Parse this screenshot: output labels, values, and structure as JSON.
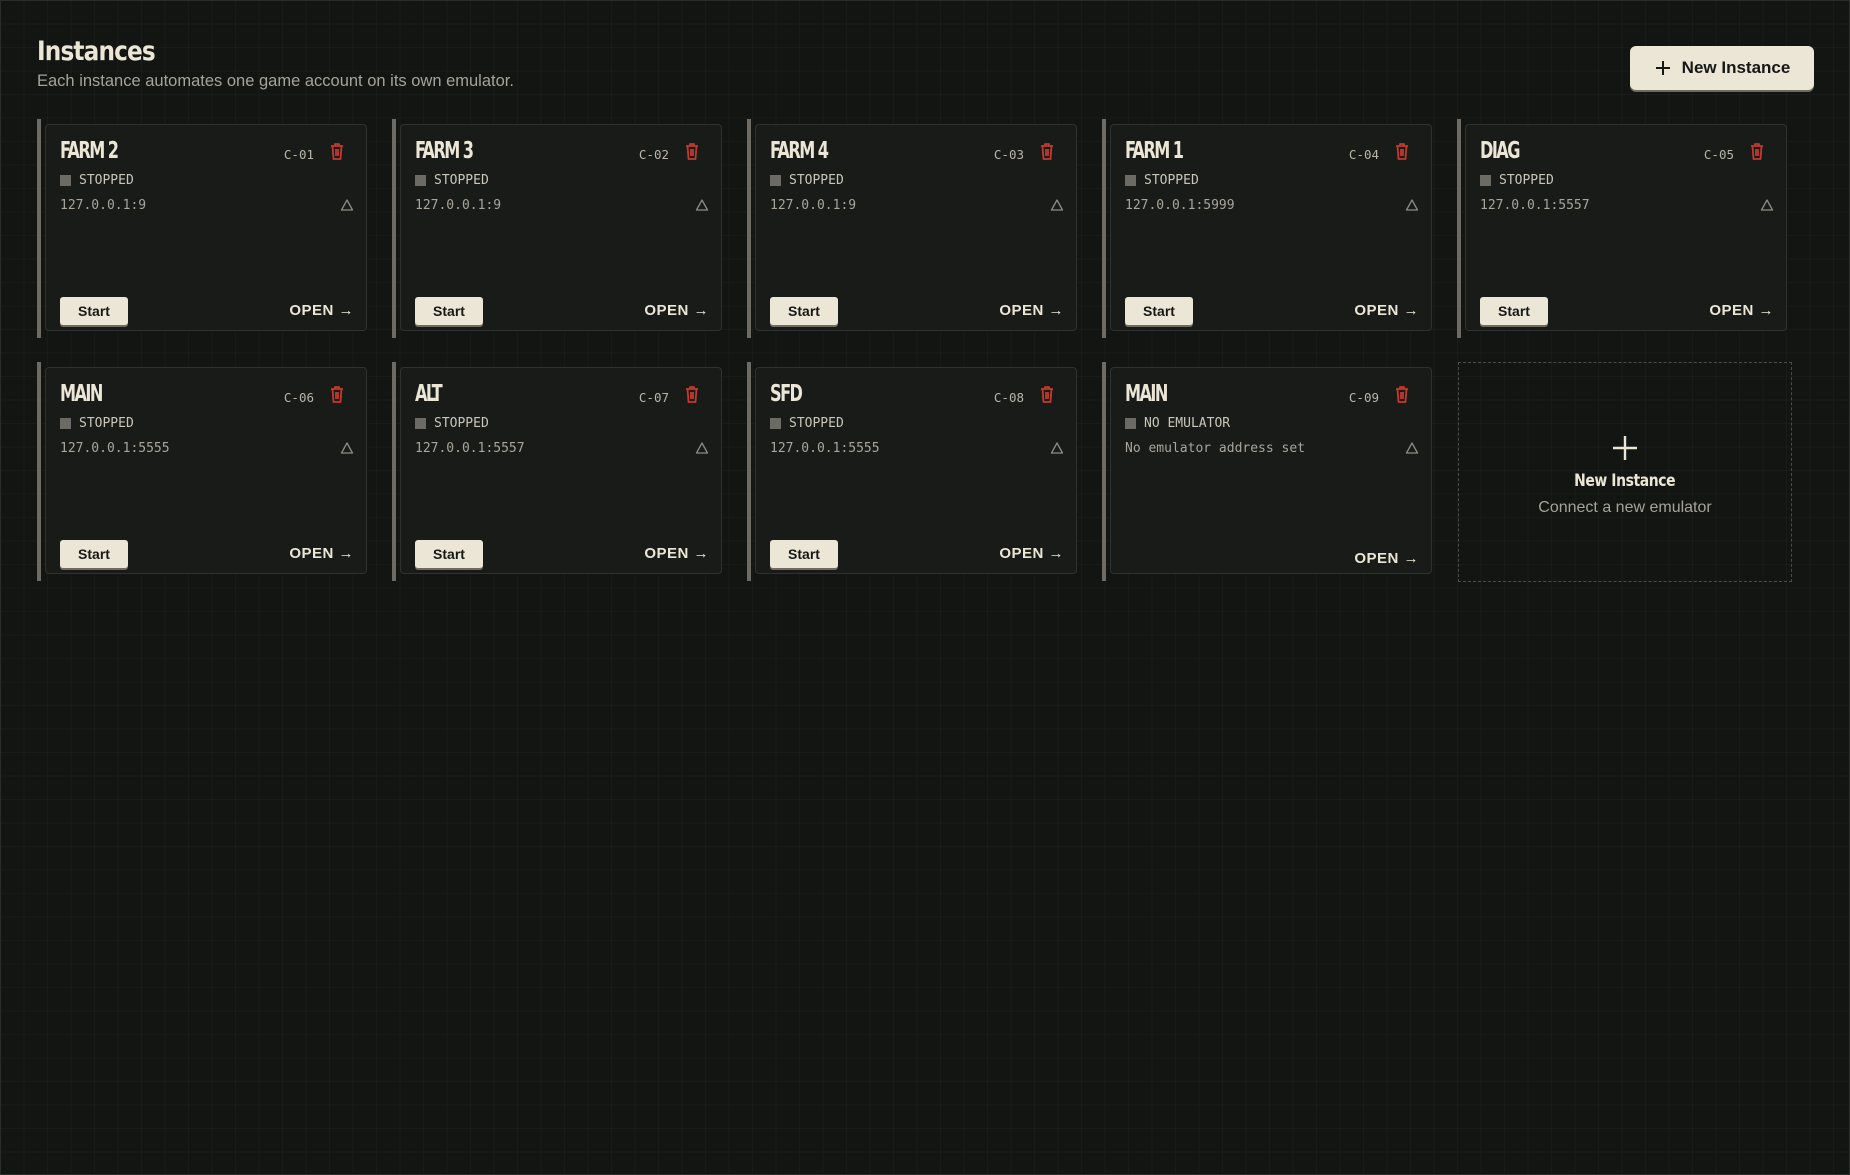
{
  "header": {
    "title": "Instances",
    "subtitle": "Each instance automates one game account on its own emulator.",
    "new_button_label": "New Instance"
  },
  "instances": [
    {
      "name": "FARM 2",
      "code": "C-01",
      "status": "STOPPED",
      "address": "127.0.0.1:9",
      "start_label": "Start",
      "open_label": "OPEN →"
    },
    {
      "name": "FARM 3",
      "code": "C-02",
      "status": "STOPPED",
      "address": "127.0.0.1:9",
      "start_label": "Start",
      "open_label": "OPEN →"
    },
    {
      "name": "FARM 4",
      "code": "C-03",
      "status": "STOPPED",
      "address": "127.0.0.1:9",
      "start_label": "Start",
      "open_label": "OPEN →"
    },
    {
      "name": "FARM 1",
      "code": "C-04",
      "status": "STOPPED",
      "address": "127.0.0.1:5999",
      "start_label": "Start",
      "open_label": "OPEN →"
    },
    {
      "name": "DIAG",
      "code": "C-05",
      "status": "STOPPED",
      "address": "127.0.0.1:5557",
      "start_label": "Start",
      "open_label": "OPEN →"
    },
    {
      "name": "MAIN",
      "code": "C-06",
      "status": "STOPPED",
      "address": "127.0.0.1:5555",
      "start_label": "Start",
      "open_label": "OPEN →"
    },
    {
      "name": "ALT",
      "code": "C-07",
      "status": "STOPPED",
      "address": "127.0.0.1:5557",
      "start_label": "Start",
      "open_label": "OPEN →"
    },
    {
      "name": "SFD",
      "code": "C-08",
      "status": "STOPPED",
      "address": "127.0.0.1:5555",
      "start_label": "Start",
      "open_label": "OPEN →"
    },
    {
      "name": "MAIN",
      "code": "C-09",
      "status": "NO EMULATOR",
      "address": "No emulator address set",
      "start_label": "",
      "open_label": "OPEN →"
    }
  ],
  "new_card": {
    "title": "New Instance",
    "subtitle": "Connect a new emulator"
  },
  "colors": {
    "background": "#121512",
    "accent": "#ece6d6",
    "danger": "#c0392b",
    "status_stopped": "#6b6a64"
  },
  "icons": {
    "delete": "trash-icon",
    "warning": "triangle-icon",
    "add": "plus-icon"
  }
}
